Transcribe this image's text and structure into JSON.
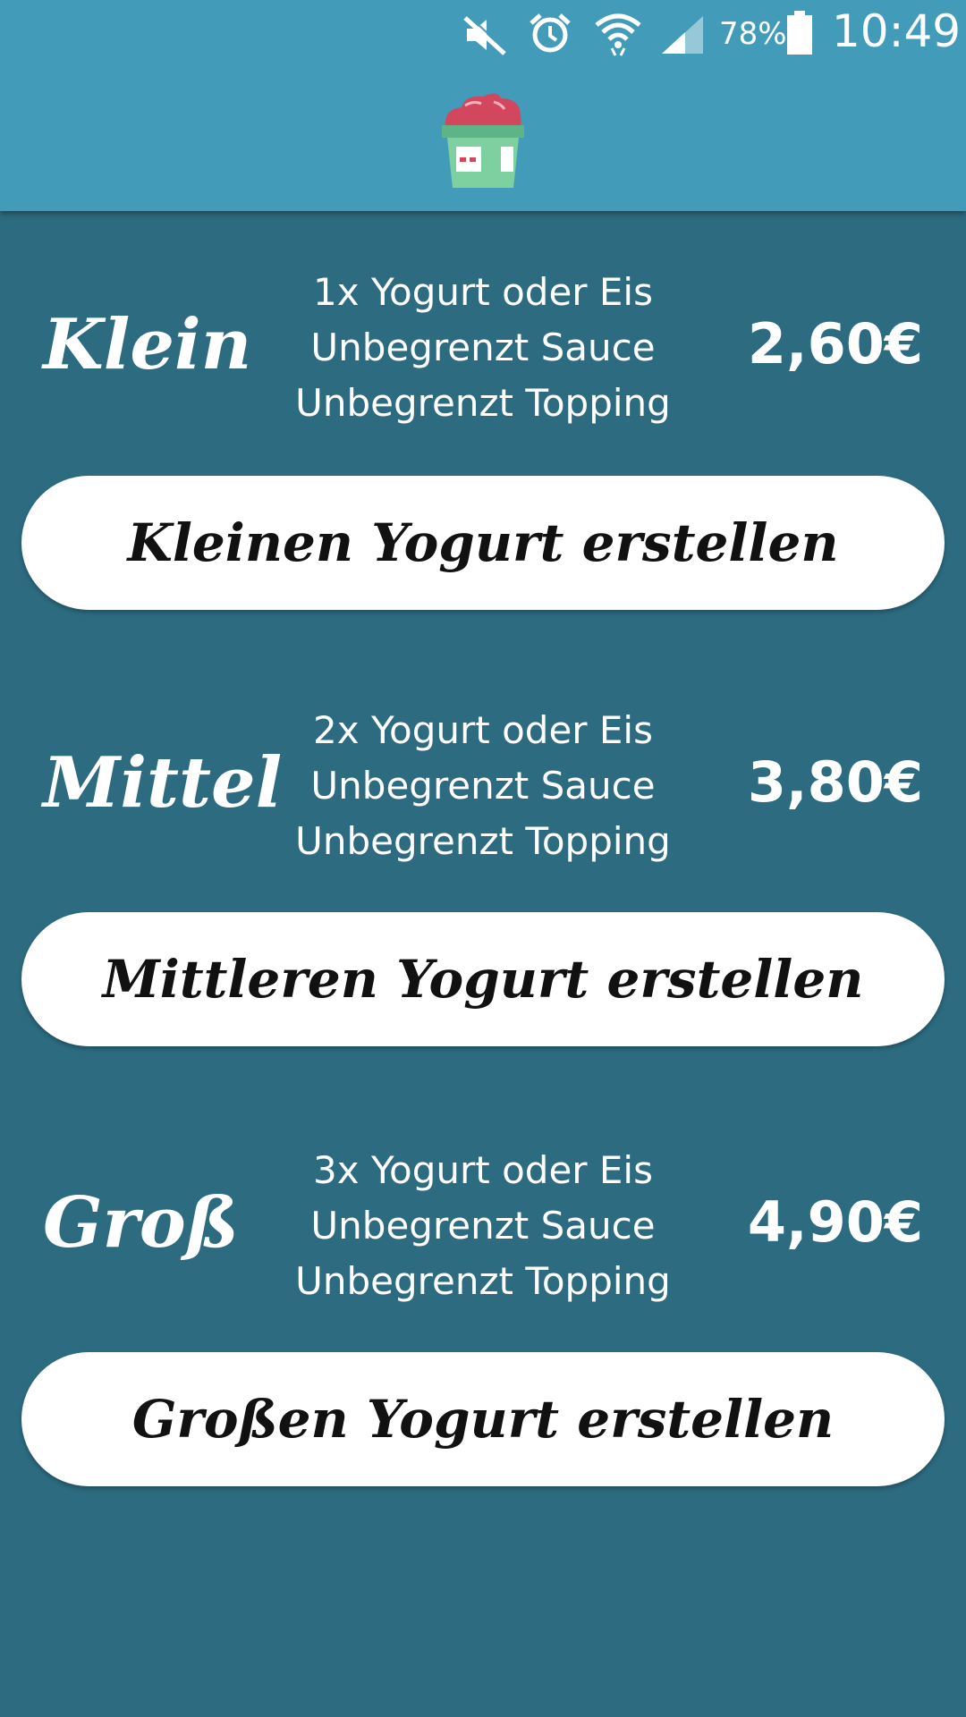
{
  "status_bar": {
    "icons": [
      "mute-icon",
      "alarm-icon",
      "wifi-icon",
      "signal-icon",
      "battery-icon"
    ],
    "battery_percent": "78%",
    "time": "10:49"
  },
  "app": {
    "logo_icon": "frozen-yogurt-cup-icon"
  },
  "colors": {
    "header": "#429cb9",
    "background": "#2d6b80",
    "button": "#ffffff"
  },
  "sizes": [
    {
      "name": "Klein",
      "lines": [
        "1x Yogurt oder Eis",
        "Unbegrenzt Sauce",
        "Unbegrenzt Topping"
      ],
      "price": "2,60€",
      "button_label": "Kleinen Yogurt erstellen"
    },
    {
      "name": "Mittel",
      "lines": [
        "2x Yogurt oder Eis",
        "Unbegrenzt Sauce",
        "Unbegrenzt Topping"
      ],
      "price": "3,80€",
      "button_label": "Mittleren Yogurt erstellen"
    },
    {
      "name": "Groß",
      "lines": [
        "3x Yogurt oder Eis",
        "Unbegrenzt Sauce",
        "Unbegrenzt Topping"
      ],
      "price": "4,90€",
      "button_label": "Großen Yogurt erstellen"
    }
  ]
}
